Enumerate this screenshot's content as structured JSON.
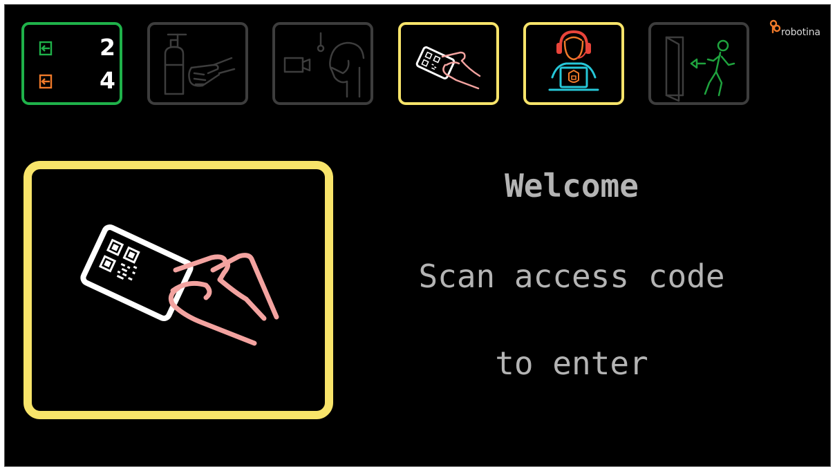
{
  "colors": {
    "background": "#000000",
    "active_step": "#f8e46a",
    "counter_border": "#1fb24a",
    "inactive_step": "#3d3d3d",
    "message_text": "#b4b4b4",
    "brand_accent": "#f07a2a",
    "hand_pink": "#f3a3a0"
  },
  "brand": {
    "logo_icon": "robotina-logo-icon",
    "name": "robotina"
  },
  "counters": [
    {
      "icon": "entry-arrow-icon",
      "value": "2"
    },
    {
      "icon": "exit-arrow-icon",
      "value": "4"
    }
  ],
  "steps": [
    {
      "icon": "hand-sanitizer-icon",
      "state": "inactive"
    },
    {
      "icon": "temperature-mask-check-icon",
      "state": "inactive"
    },
    {
      "icon": "qr-card-scan-icon",
      "state": "active"
    },
    {
      "icon": "operator-support-icon",
      "state": "active"
    },
    {
      "icon": "walk-through-door-icon",
      "state": "inactive"
    }
  ],
  "scan_panel": {
    "icon": "qr-card-hand-icon"
  },
  "message": {
    "title": "Welcome",
    "line1": "Scan access code",
    "line2": "to enter"
  }
}
